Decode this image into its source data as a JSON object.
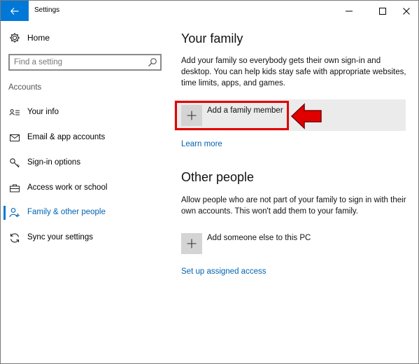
{
  "window": {
    "title": "Settings"
  },
  "sidebar": {
    "home_label": "Home",
    "search_placeholder": "Find a setting",
    "section_label": "Accounts",
    "items": [
      {
        "label": "Your info",
        "icon": "person-card-icon",
        "active": false
      },
      {
        "label": "Email & app accounts",
        "icon": "envelope-icon",
        "active": false
      },
      {
        "label": "Sign-in options",
        "icon": "key-icon",
        "active": false
      },
      {
        "label": "Access work or school",
        "icon": "briefcase-icon",
        "active": false
      },
      {
        "label": "Family & other people",
        "icon": "person-add-icon",
        "active": true
      },
      {
        "label": "Sync your settings",
        "icon": "sync-icon",
        "active": false
      }
    ]
  },
  "family": {
    "heading": "Your family",
    "description": "Add your family so everybody gets their own sign-in and desktop. You can help kids stay safe with appropriate websites, time limits, apps, and games.",
    "add_label": "Add a family member",
    "learn_more": "Learn more"
  },
  "other": {
    "heading": "Other people",
    "description": "Allow people who are not part of your family to sign in with their own accounts. This won't add them to your family.",
    "add_label": "Add someone else to this PC",
    "assigned_access": "Set up assigned access"
  },
  "colors": {
    "accent": "#0078d7",
    "link": "#0063b1",
    "annotation": "#e00000"
  }
}
